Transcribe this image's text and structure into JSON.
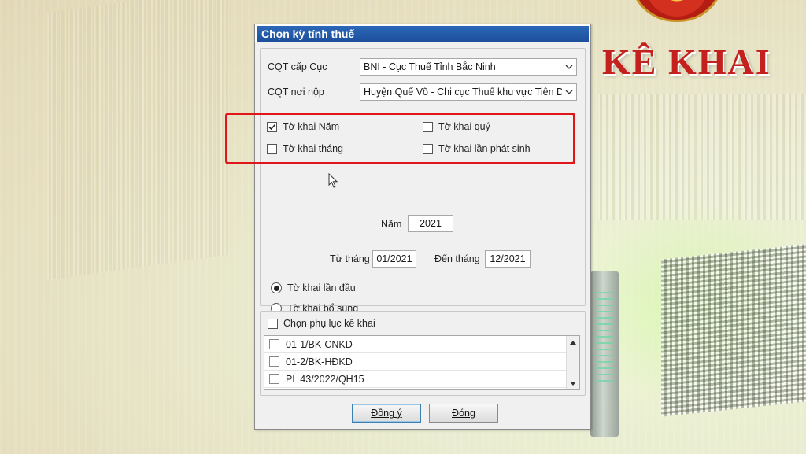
{
  "background": {
    "brand_title": "KÊ KHAI"
  },
  "dialog": {
    "title": "Chọn kỳ tính thuế",
    "cqt_cap_cuc": {
      "label": "CQT cấp Cục",
      "value": "BNI - Cục Thuế Tỉnh Bắc Ninh"
    },
    "cqt_noi_nop": {
      "label": "CQT nơi nộp",
      "value": "Huyện Quế Võ - Chi cục Thuế khu vực Tiên D"
    },
    "period_types": [
      {
        "label": "Tờ khai Năm",
        "checked": true
      },
      {
        "label": "Tờ khai quý",
        "checked": false
      },
      {
        "label": "Tờ khai tháng",
        "checked": false
      },
      {
        "label": "Tờ khai lần phát sinh",
        "checked": false
      }
    ],
    "year": {
      "label": "Năm",
      "value": "2021"
    },
    "from_month": {
      "label": "Từ tháng",
      "value": "01/2021"
    },
    "to_month": {
      "label": "Đến tháng",
      "value": "12/2021"
    },
    "declaration_types": [
      {
        "label": "Tờ khai lần đầu",
        "selected": true
      },
      {
        "label": "Tờ khai bổ sung",
        "selected": false
      }
    ],
    "appendix": {
      "label": "Chọn phụ lục kê khai",
      "checked": false,
      "items": [
        {
          "label": "01-1/BK-CNKD",
          "checked": false
        },
        {
          "label": "01-2/BK-HĐKD",
          "checked": false
        },
        {
          "label": "PL 43/2022/QH15",
          "checked": false
        }
      ]
    },
    "buttons": {
      "ok": "Đồng ý",
      "close": "Đóng"
    }
  },
  "colors": {
    "highlight": "#e0161b",
    "title_bar": "#1c4f9c",
    "brand_red": "#c4201e"
  }
}
